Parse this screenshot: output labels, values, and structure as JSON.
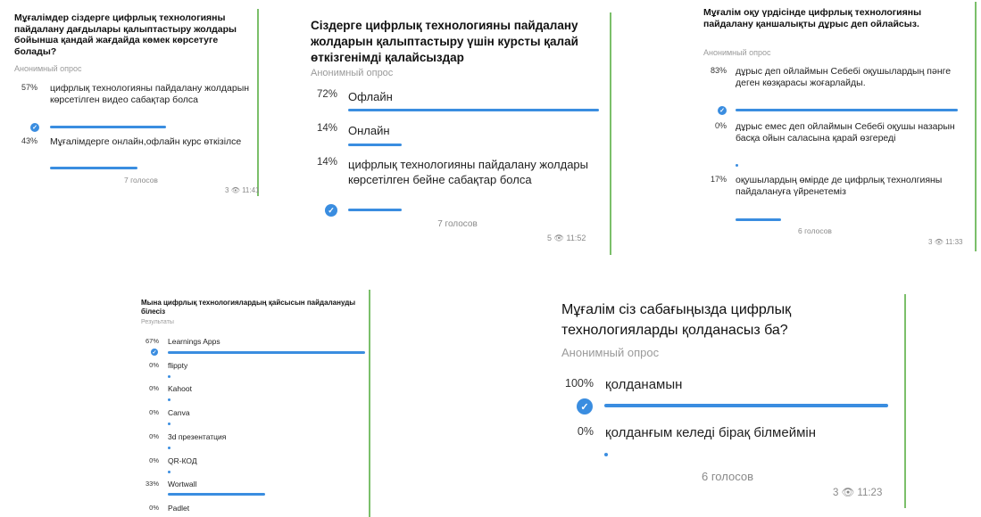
{
  "card1": {
    "title": "Мұғалімдер сіздерге цифрлық технологияны пайдалану дағдылары қалыптастыру жолдары бойынша қандай жағдайда көмек көрсетуге болады?",
    "subtitle": "Анонимный опрос",
    "options": [
      {
        "pct": "57%",
        "text": "цифрлық технологияны пайдалану жолдарын көрсетілген видео сабақтар болса",
        "fill": 0.57
      },
      {
        "pct": "43%",
        "text": "Мұғалімдерге онлайн,офлайн курс өткізілсе",
        "fill": 0.43
      }
    ],
    "votes": "7 голосов",
    "views": "3",
    "time": "11:41"
  },
  "card2": {
    "title": "Сіздерге цифрлық технологияны пайдалану жолдарын қалыптастыру үшін курсты қалай өткізгенімді қалайсыздар",
    "subtitle": "Анонимный опрос",
    "options": [
      {
        "pct": "72%",
        "text": "Офлайн",
        "fill": 0.72
      },
      {
        "pct": "14%",
        "text": "Онлайн",
        "fill": 0.14
      },
      {
        "pct": "14%",
        "text": "цифрлық технологияны пайдалану жолдары көрсетілген бейне сабақтар болса",
        "fill": 0.14
      }
    ],
    "votes": "7 голосов",
    "views": "5",
    "time": "11:52"
  },
  "card3": {
    "title": "Мұғалім оқу үрдісінде цифрлық технологияны пайдалану қаншалықты дұрыс деп ойлайсыз.",
    "subtitle": "Анонимный опрос",
    "options": [
      {
        "pct": "83%",
        "text": "дұрыс деп ойлаймын Себебі оқушылардың пәнге деген көзқарасы жоғарлайды.",
        "fill": 0.83
      },
      {
        "pct": "0%",
        "text": "дұрыс емес деп ойлаймын Себебі оқушы назарын басқа ойын саласына қарай өзгереді",
        "fill": 0
      },
      {
        "pct": "17%",
        "text": "оқушылардың өмірде де цифрлық технолгияны пайдалануға үйренетеміз",
        "fill": 0.17
      }
    ],
    "votes": "6 голосов",
    "views": "3",
    "time": "11:33"
  },
  "card4": {
    "title": "Мына цифрлық технологиялардың қайсысын пайдалануды білесіз",
    "subtitle": "Результаты",
    "options": [
      {
        "pct": "67%",
        "text": "Learnings Apps",
        "fill": 0.67
      },
      {
        "pct": "0%",
        "text": "flippty",
        "fill": 0
      },
      {
        "pct": "0%",
        "text": "Kahoot",
        "fill": 0
      },
      {
        "pct": "0%",
        "text": "Canva",
        "fill": 0
      },
      {
        "pct": "0%",
        "text": "3d презентатция",
        "fill": 0
      },
      {
        "pct": "0%",
        "text": "QR-КОД",
        "fill": 0
      },
      {
        "pct": "33%",
        "text": "Wortwall",
        "fill": 0.33
      },
      {
        "pct": "0%",
        "text": "Padlet",
        "fill": 0
      }
    ]
  },
  "card5": {
    "title": "Мұғалім сіз сабағыңызда цифрлық технологияларды қолданасыз ба?",
    "subtitle": "Анонимный опрос",
    "options": [
      {
        "pct": "100%",
        "text": "қолданамын",
        "fill": 1.0
      },
      {
        "pct": "0%",
        "text": "қолданғым келеді бірақ білмеймін",
        "fill": 0
      }
    ],
    "votes": "6 голосов",
    "views": "3",
    "time": "11:23"
  },
  "colors": {
    "accent": "#3a8de0",
    "border": "#7bbf6a"
  }
}
